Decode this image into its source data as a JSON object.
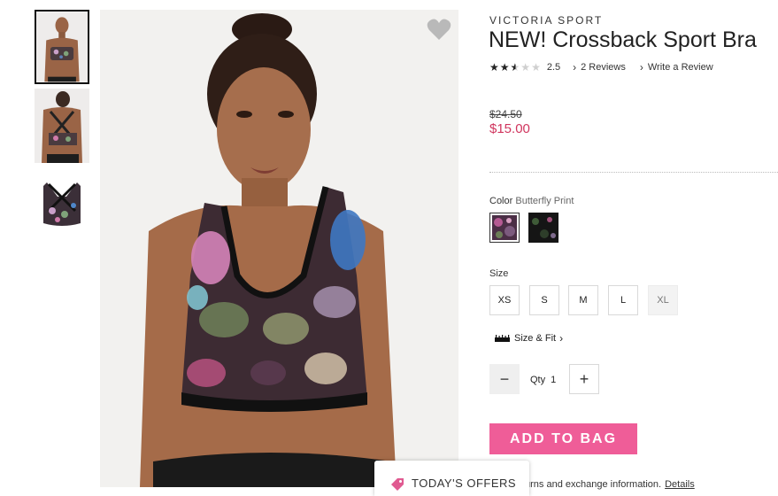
{
  "thumbnails": [
    {
      "name": "thumbnail-front",
      "selected": true
    },
    {
      "name": "thumbnail-back",
      "selected": false
    },
    {
      "name": "thumbnail-flat",
      "selected": false
    }
  ],
  "product": {
    "brand": "VICTORIA SPORT",
    "title": "NEW! Crossback Sport Bra",
    "rating": 2.5,
    "rating_text": "2.5",
    "reviews_link": "2 Reviews",
    "write_review_link": "Write a Review",
    "original_price": "$24.50",
    "sale_price": "$15.00"
  },
  "color": {
    "label": "Color",
    "selected_value": "Butterfly Print",
    "swatches": [
      "Butterfly Print",
      "Black Floral"
    ]
  },
  "size": {
    "label": "Size",
    "options": [
      {
        "label": "XS",
        "available": true
      },
      {
        "label": "S",
        "available": true
      },
      {
        "label": "M",
        "available": true
      },
      {
        "label": "L",
        "available": true
      },
      {
        "label": "XL",
        "available": false
      }
    ],
    "fit_link": "Size & Fit"
  },
  "quantity": {
    "label": "Qty",
    "value": "1"
  },
  "actions": {
    "add_to_bag": "ADD TO BAG"
  },
  "returns": {
    "text": "urns and exchange information.",
    "details_link": "Details"
  },
  "offers_tab": {
    "label": "TODAY'S OFFERS"
  },
  "colors": {
    "sale_price": "#d0355e",
    "add_to_bag_bg": "#ef5d98"
  },
  "icons": {
    "wishlist": "heart-icon",
    "fit": "ruler-icon",
    "offers": "tag-icon"
  }
}
